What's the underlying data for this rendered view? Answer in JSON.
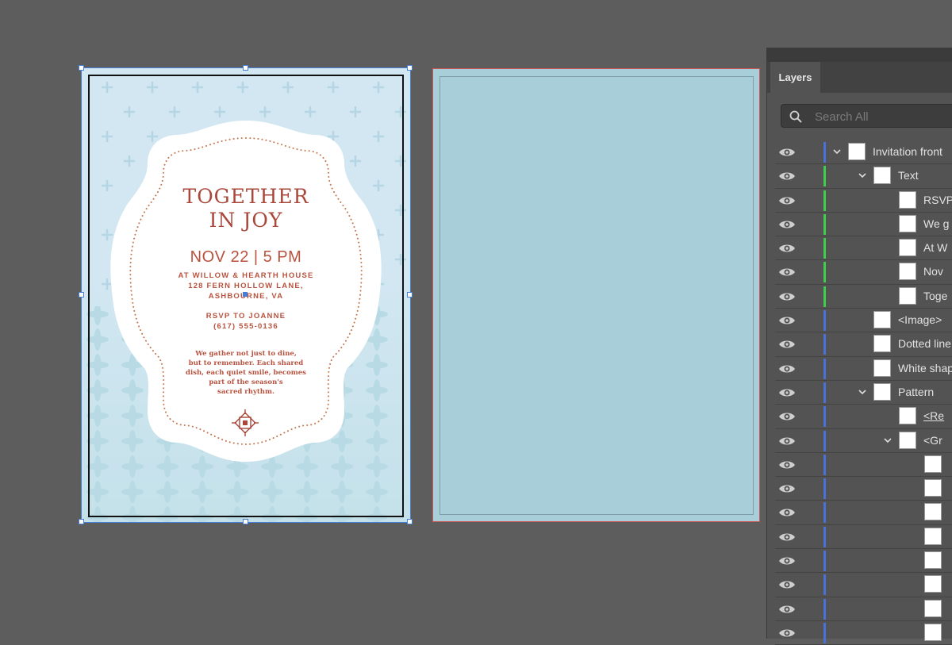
{
  "invitation": {
    "title_line1": "TOGETHER",
    "title_line2": "IN JOY",
    "date": "NOV 22 | 5 PM",
    "address_line1": "AT WILLOW & HEARTH HOUSE",
    "address_line2": "128 FERN HOLLOW LANE,",
    "address_line3": "ASHBOURNE, VA",
    "rsvp_line1": "RSVP TO JOANNE",
    "rsvp_line2": "(617) 555-0136",
    "body_lines": [
      "We gather not just to dine,",
      "but to remember. Each shared",
      "dish, each quiet smile, becomes",
      "part of the season's",
      "sacred rhythm."
    ],
    "colors": {
      "background": "#d2e7f2",
      "accent": "#a8473a",
      "dots": "#c57a52"
    }
  },
  "artboard2": {
    "fill": "#a8ceda"
  },
  "layers_panel": {
    "tab_label": "Layers",
    "search_placeholder": "Search All",
    "rows": [
      {
        "name": "Invitation front",
        "level": 0,
        "expanded": true,
        "color": "#4a70d9",
        "icon": "eye-icon"
      },
      {
        "name": "Text",
        "level": 1,
        "expanded": true,
        "color": "#3ecf4a",
        "icon": "eye-icon"
      },
      {
        "name": "RSVP",
        "level": 2,
        "color": "#3ecf4a",
        "icon": "eye-icon"
      },
      {
        "name": "We g",
        "level": 2,
        "color": "#3ecf4a",
        "icon": "eye-icon"
      },
      {
        "name": "At W",
        "level": 2,
        "color": "#3ecf4a",
        "icon": "eye-icon"
      },
      {
        "name": "Nov",
        "level": 2,
        "color": "#3ecf4a",
        "icon": "eye-icon"
      },
      {
        "name": "Toge",
        "level": 2,
        "color": "#3ecf4a",
        "icon": "eye-icon"
      },
      {
        "name": "<Image>",
        "level": 1,
        "color": "#4a70d9",
        "icon": "eye-icon"
      },
      {
        "name": "Dotted line",
        "level": 1,
        "color": "#4a70d9",
        "icon": "eye-icon"
      },
      {
        "name": "White shape",
        "level": 1,
        "color": "#4a70d9",
        "icon": "eye-icon"
      },
      {
        "name": "Pattern",
        "level": 1,
        "expanded": true,
        "color": "#4a70d9",
        "icon": "eye-icon"
      },
      {
        "name": "<Re",
        "level": 2,
        "color": "#4a70d9",
        "icon": "eye-icon",
        "underline": true
      },
      {
        "name": "<Gr",
        "level": 2,
        "expanded": true,
        "color": "#4a70d9",
        "icon": "eye-icon"
      },
      {
        "name": "",
        "level": 3,
        "color": "#4a70d9",
        "icon": "eye-icon"
      },
      {
        "name": "",
        "level": 3,
        "color": "#4a70d9",
        "icon": "eye-icon"
      },
      {
        "name": "",
        "level": 3,
        "color": "#4a70d9",
        "icon": "eye-icon"
      },
      {
        "name": "",
        "level": 3,
        "color": "#4a70d9",
        "icon": "eye-icon"
      },
      {
        "name": "",
        "level": 3,
        "color": "#4a70d9",
        "icon": "eye-icon"
      },
      {
        "name": "",
        "level": 3,
        "color": "#4a70d9",
        "icon": "eye-icon"
      },
      {
        "name": "",
        "level": 3,
        "color": "#4a70d9",
        "icon": "eye-icon"
      },
      {
        "name": "",
        "level": 3,
        "color": "#4a70d9",
        "icon": "eye-icon"
      }
    ]
  }
}
